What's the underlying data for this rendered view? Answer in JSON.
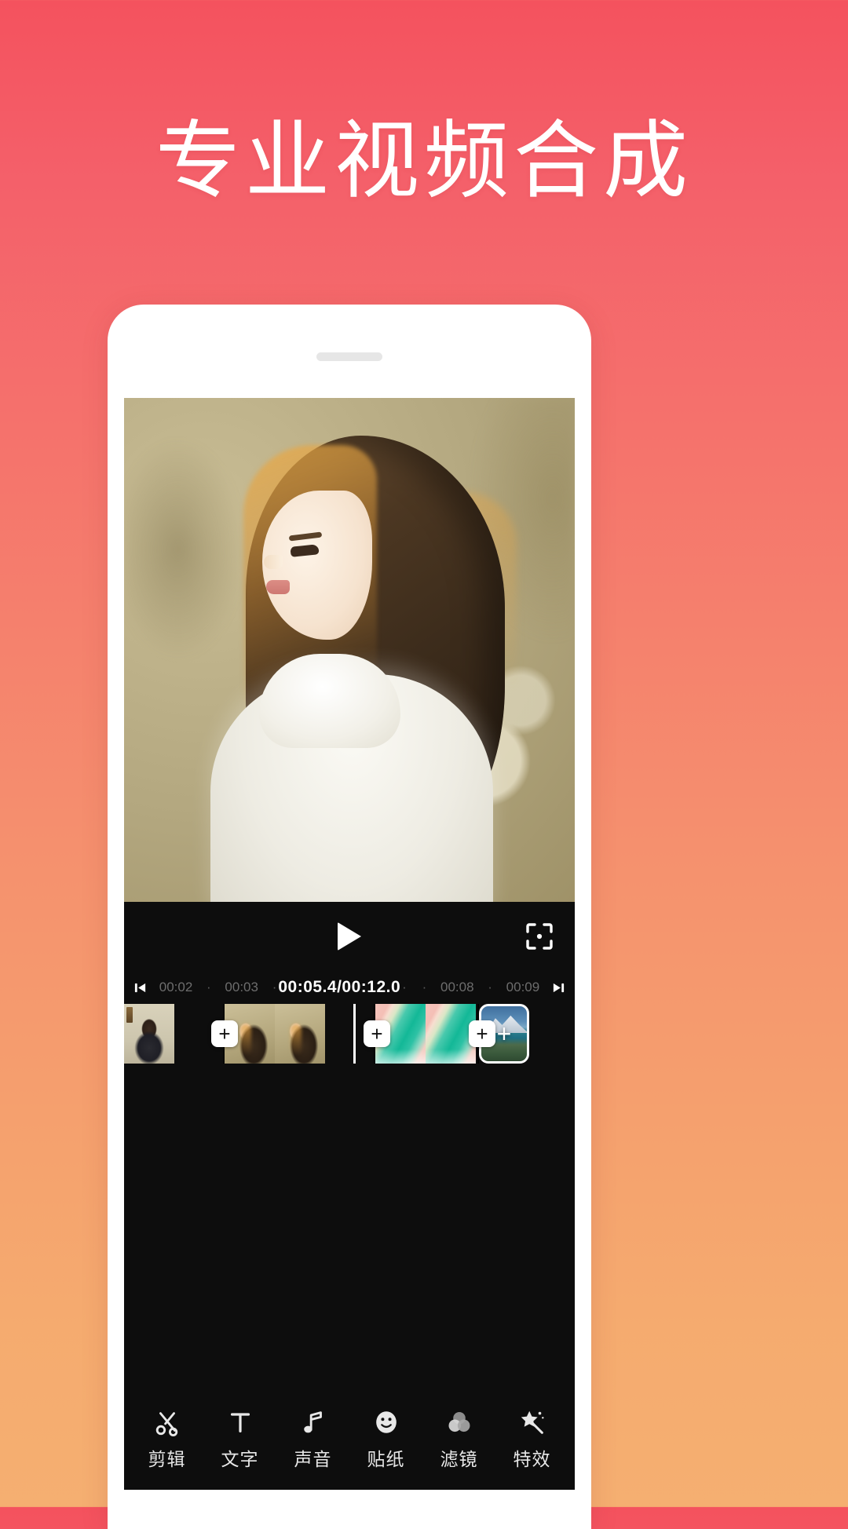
{
  "headline": "专业视频合成",
  "theme": {
    "gradient_top": "#f4525e",
    "gradient_bottom": "#f5af71",
    "screen_bg": "#0d0d0d",
    "accent_white": "#ffffff"
  },
  "phone": {
    "speaker_name": "earpiece-speaker"
  },
  "player": {
    "play_label": "▶",
    "crop_label": "crop-frame-icon",
    "preview_alt": "video-preview"
  },
  "ruler": {
    "skip_prev_icon": "skip-previous-icon",
    "skip_next_icon": "skip-next-icon",
    "left_ticks": [
      "00:02",
      "00:03"
    ],
    "right_ticks": [
      "00:08",
      "00:09"
    ],
    "current_time": "00:05.4",
    "total_time": "00:12.0",
    "time_display": "00:05.4/00:12.0",
    "dot": "·"
  },
  "timeline": {
    "add_label": "+",
    "clips": [
      {
        "name": "clip-1",
        "style": "fA",
        "frames": 2
      },
      {
        "name": "clip-2",
        "style": "fB",
        "frames": 3
      },
      {
        "name": "clip-3",
        "style": "fC",
        "frames": 2
      }
    ],
    "add_tile_label": "+",
    "playhead_position_pct": 62
  },
  "toolbar": {
    "items": [
      {
        "label": "剪辑",
        "icon": "scissors-icon"
      },
      {
        "label": "文字",
        "icon": "text-t-icon"
      },
      {
        "label": "声音",
        "icon": "music-note-icon"
      },
      {
        "label": "贴纸",
        "icon": "sticker-smiley-icon"
      },
      {
        "label": "滤镜",
        "icon": "filter-circles-icon"
      },
      {
        "label": "特效",
        "icon": "magic-wand-star-icon"
      }
    ]
  }
}
